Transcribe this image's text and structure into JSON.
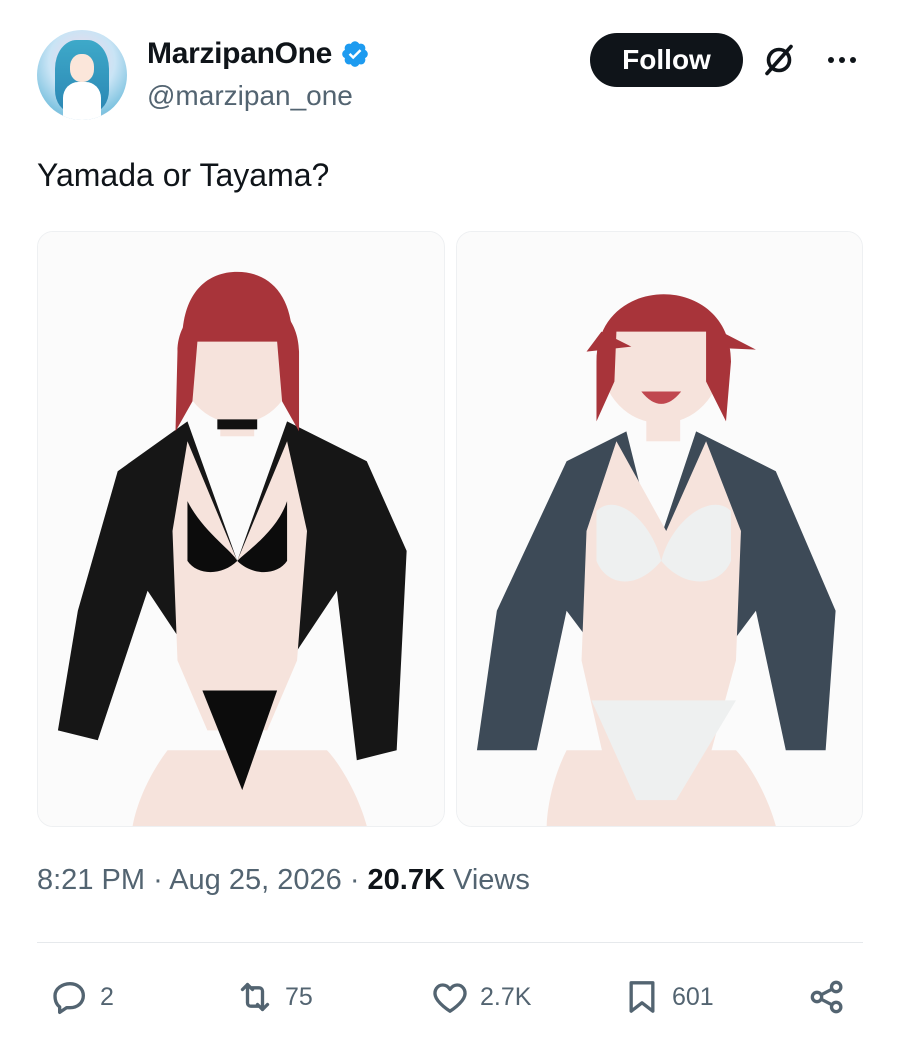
{
  "author": {
    "display_name": "MarzipanOne",
    "handle": "@marzipan_one",
    "verified": true,
    "verified_color": "#1d9bf0"
  },
  "header": {
    "follow_label": "Follow",
    "grok_icon": "slashed-circle-icon",
    "more_icon": "more-dots-icon"
  },
  "tweet": {
    "text": "Yamada or Tayama?",
    "media_count": 2
  },
  "meta": {
    "time": "8:21 PM",
    "separator": "·",
    "date": "Aug 25, 2026",
    "views_count": "20.7K",
    "views_label": "Views"
  },
  "actions": {
    "replies": "2",
    "reposts": "75",
    "likes": "2.7K",
    "bookmarks": "601",
    "icons": [
      "reply-icon",
      "repost-icon",
      "like-icon",
      "bookmark-icon",
      "share-icon"
    ]
  },
  "colors": {
    "text_primary": "#0f1419",
    "text_secondary": "#536471",
    "button_bg": "#0f1419"
  }
}
